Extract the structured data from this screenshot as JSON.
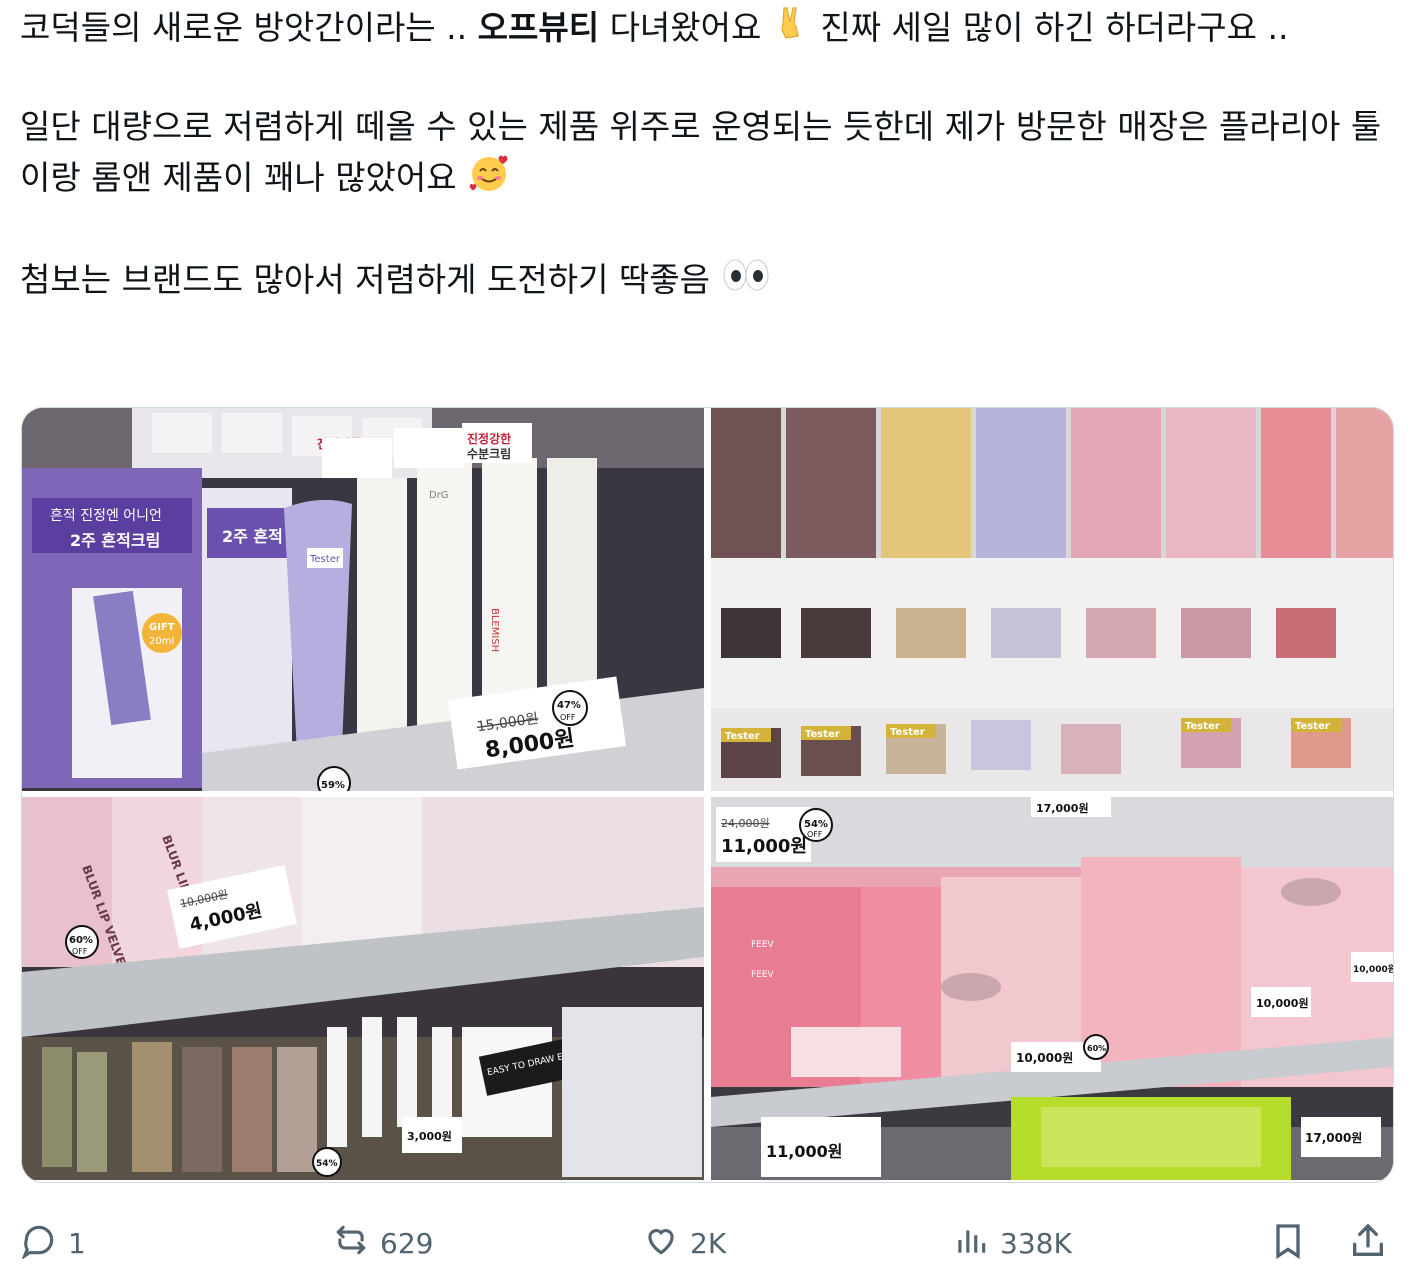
{
  "tweet": {
    "line1_a": "코덕들의 새로운 방앗간이라는 .. ",
    "brand": "오프뷰티",
    "line1_b": " 다녀왔어요 ",
    "line1_c": " 진짜 세일 많이 하긴 하더라구요 ..",
    "para2": "일단 대량으로 저렴하게 떼올 수 있는 제품 위주로 운영되는 듯한데 제가 방문한 매장은 플라리아 툴이랑 롬앤 제품이 꽤나 많았어요 ",
    "para3": "첨보는 브랜드도 많아서 저렴하게 도전하기 딱좋음 ",
    "emoji_victory": "victory-hand-emoji",
    "emoji_smile": "smiling-face-with-hearts-emoji",
    "emoji_eyes": "eyes-emoji"
  },
  "photos": {
    "photo1": {
      "box_text_1": "흔적 진정엔 어니언",
      "box_text_2": "2주 흔적크림",
      "box_text_3": "2주 흔적",
      "gift": "GIFT",
      "gift_size": "20ml",
      "shelf_label_1": "진정강한",
      "shelf_label_2": "수분크림",
      "price_old": "15,000원",
      "price_new": "8,000원",
      "discount": "47%",
      "discount_off": "OFF",
      "discount2": "59%",
      "tester": "Tester",
      "tube_label": "BLEMISH",
      "brand_box": "DrG"
    },
    "photo2": {
      "tester": "Tester"
    },
    "photo3": {
      "product": "BLUR LIP VELVET",
      "price_old": "10,000원",
      "price_new": "4,000원",
      "discount": "60%",
      "discount_off": "OFF",
      "small_price": "3,000원",
      "easy_draw": "EASY TO DRAW EYEBROW",
      "discount3": "54%"
    },
    "photo4": {
      "price_old": "24,000원",
      "price_new": "11,000원",
      "discount": "54%",
      "discount_off": "OFF",
      "price_top": "17,000원",
      "price_right": "10,000원",
      "price_mid": "10,000원",
      "discount2": "60%",
      "feev": "FEEV",
      "price_right2": "17,000원"
    }
  },
  "actions": {
    "reply_count": "1",
    "retweet_count": "629",
    "like_count": "2K",
    "view_count": "338K"
  },
  "colors": {
    "text": "#0f1419",
    "secondary": "#536471",
    "border": "#cfd9de"
  }
}
